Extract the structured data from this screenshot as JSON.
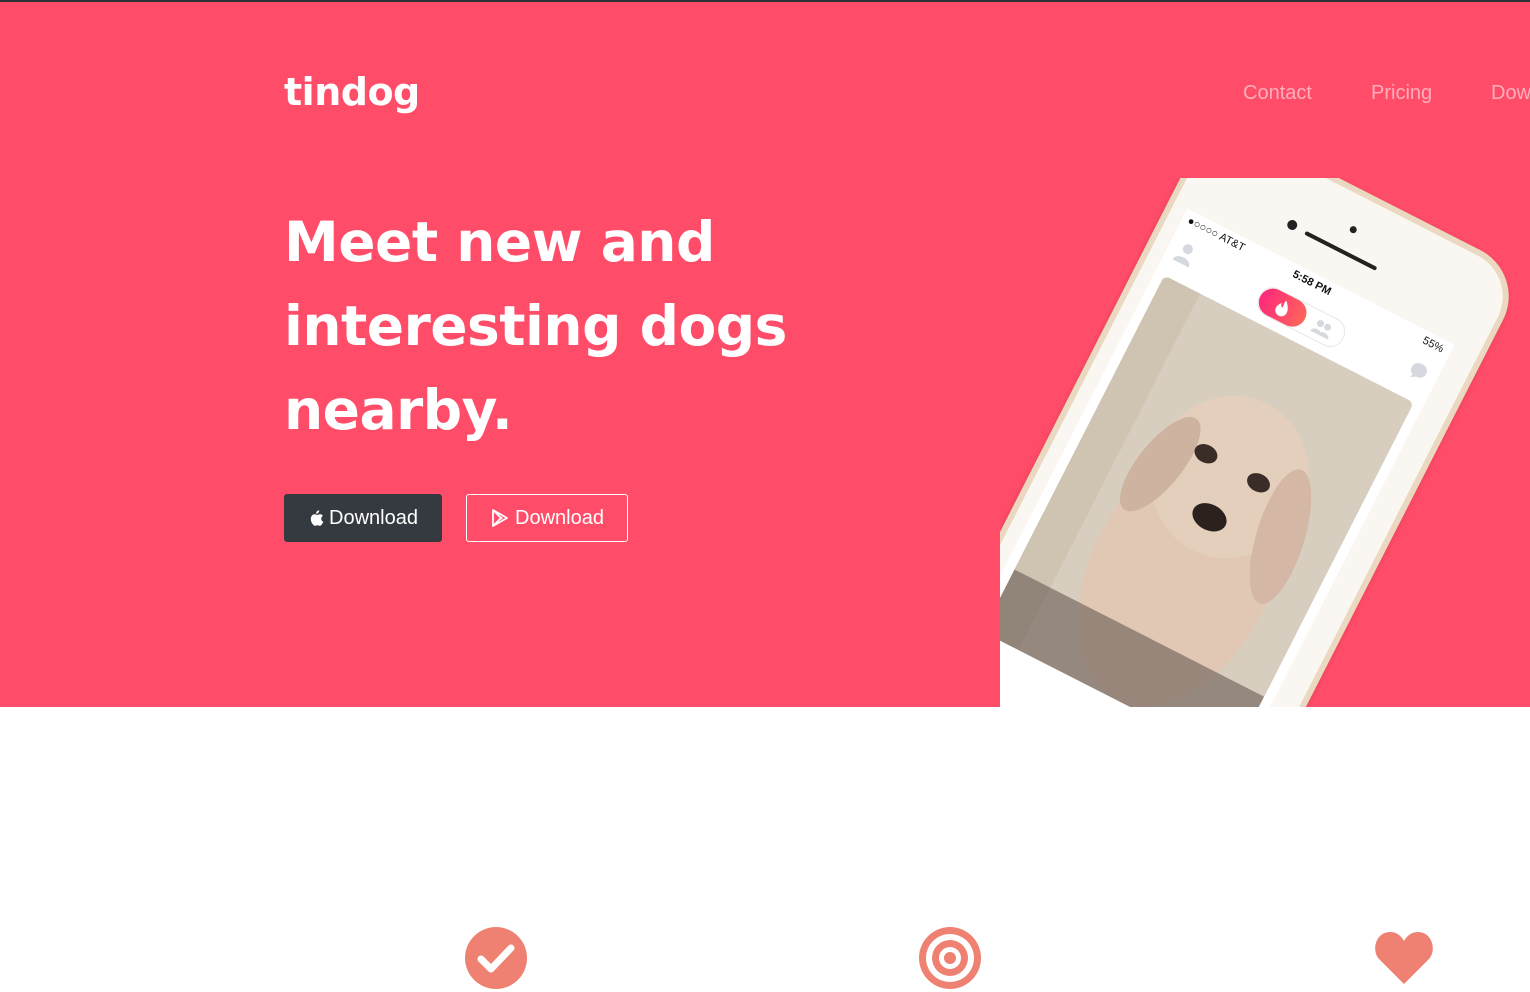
{
  "brand": {
    "name": "tindog"
  },
  "nav": {
    "items": [
      "Contact",
      "Pricing",
      "Download"
    ]
  },
  "hero": {
    "headline": "Meet new and interesting dogs nearby.",
    "buttons": [
      {
        "label": "Download",
        "icon": "apple-icon",
        "style": "dark"
      },
      {
        "label": "Download",
        "icon": "google-play-icon",
        "style": "outline"
      }
    ]
  },
  "phone": {
    "carrier": "●○○○○ AT&T",
    "time": "5:58 PM",
    "battery": "55%"
  },
  "features": {
    "icons": [
      "check-circle-icon",
      "bullseye-icon",
      "heart-icon"
    ]
  },
  "colors": {
    "hero_bg": "#ff4c68",
    "button_dark": "#343a40",
    "feature_icon": "#ef8172",
    "text_white": "#ffffff"
  }
}
